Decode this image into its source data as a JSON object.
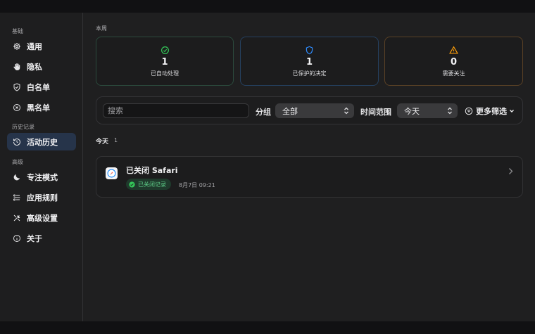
{
  "sidebar": {
    "sections": [
      {
        "label": "基础"
      },
      {
        "label": "历史记录"
      },
      {
        "label": "高级"
      }
    ],
    "items": [
      {
        "label": "通用",
        "icon": "gear-icon"
      },
      {
        "label": "隐私",
        "icon": "hand-icon"
      },
      {
        "label": "白名单",
        "icon": "shield-check-icon"
      },
      {
        "label": "黑名单",
        "icon": "x-circle-icon"
      },
      {
        "label": "活动历史",
        "icon": "history-icon",
        "active": true
      },
      {
        "label": "专注模式",
        "icon": "moon-icon"
      },
      {
        "label": "应用规则",
        "icon": "list-rules-icon"
      },
      {
        "label": "高级设置",
        "icon": "tools-icon"
      },
      {
        "label": "关于",
        "icon": "info-icon"
      }
    ]
  },
  "main": {
    "week_label": "本周",
    "stats": [
      {
        "value": "1",
        "label": "已自动处理",
        "icon": "check-circle-icon",
        "color": "#34c759"
      },
      {
        "value": "1",
        "label": "已保护的决定",
        "icon": "shield-icon",
        "color": "#2f8cff"
      },
      {
        "value": "0",
        "label": "需要关注",
        "icon": "warning-icon",
        "color": "#ff9f0a"
      }
    ],
    "filters": {
      "search_placeholder": "搜索",
      "group_label": "分组",
      "group_value": "全部",
      "time_label": "时间范围",
      "time_value": "今天",
      "more_label": "更多筛选"
    },
    "day_group": {
      "label": "今天",
      "count": "1"
    },
    "records": [
      {
        "title": "已关闭 Safari",
        "badge": "已关闭记录",
        "time": "8月7日 09:21",
        "app_icon": "safari-icon"
      }
    ]
  },
  "colors": {
    "accent_blue": "#2f8cff",
    "success_green": "#34c759",
    "warning_orange": "#ff9f0a",
    "active_nav_bg": "#26344a"
  }
}
